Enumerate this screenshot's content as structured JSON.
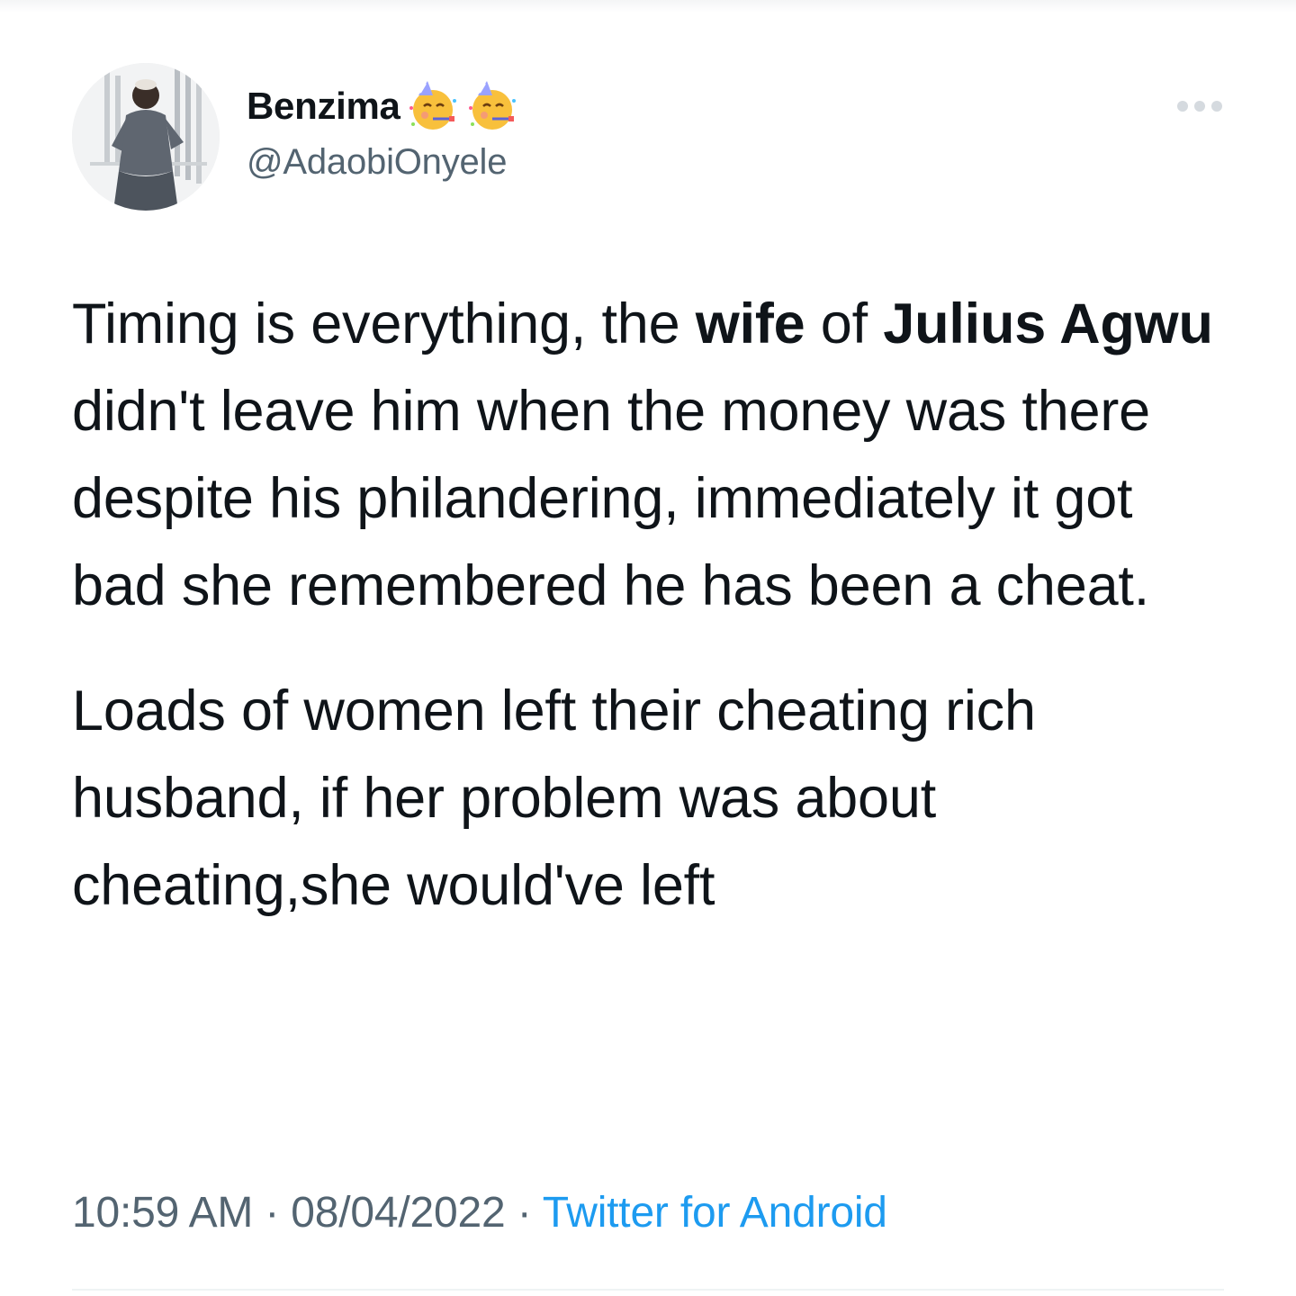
{
  "tweet": {
    "author": {
      "display_name": "Benzima",
      "handle": "@AdaobiOnyele",
      "emojis": [
        "partying-face-emoji",
        "partying-face-emoji"
      ],
      "avatar_icon": "profile-photo"
    },
    "menu_icon": "more-options-icon",
    "paragraph1": {
      "t1": "Timing is everything, the ",
      "b1": "wife",
      "t2": " of ",
      "b2": "Julius Agwu",
      "t3": " didn't leave him when the money was there despite his philandering, immediately it got bad she remembered he has been a cheat."
    },
    "paragraph2": "Loads of women left their cheating rich husband, if her problem was about cheating,she would've left",
    "time": "10:59 AM",
    "separator": "·",
    "date": "08/04/2022",
    "source": "Twitter for Android"
  },
  "colors": {
    "text": "#0f1419",
    "secondary": "#536471",
    "link": "#1d9bf0",
    "divider": "#eff3f4"
  }
}
